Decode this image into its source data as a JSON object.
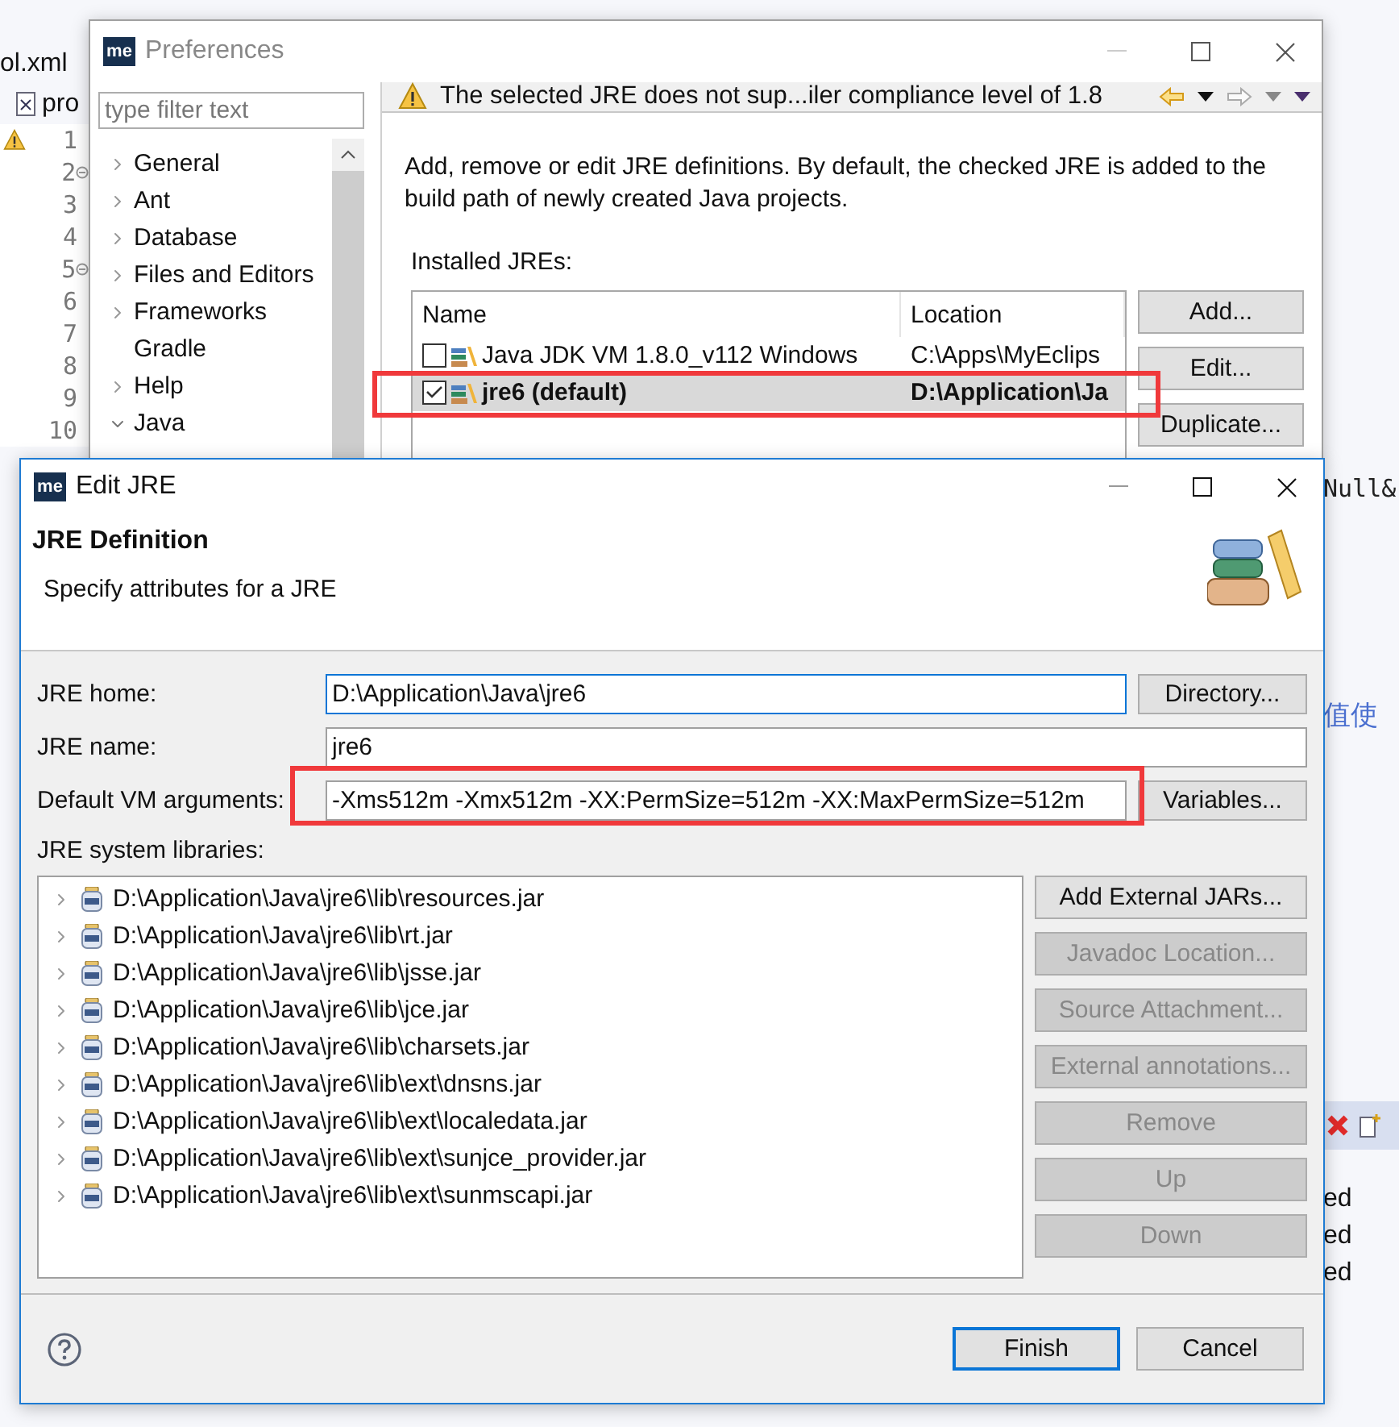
{
  "ide": {
    "editor_tabs": [
      {
        "label": "ol.xml",
        "kind": "plain"
      },
      {
        "label": "pro",
        "kind": "xml"
      }
    ],
    "line_numbers": [
      {
        "text": "1",
        "fold": false,
        "warning": true
      },
      {
        "text": "2",
        "fold": true,
        "warning": false
      },
      {
        "text": "3",
        "fold": false,
        "warning": false
      },
      {
        "text": "4",
        "fold": false,
        "warning": false
      },
      {
        "text": "5",
        "fold": true,
        "warning": false
      },
      {
        "text": "6",
        "fold": false,
        "warning": false
      },
      {
        "text": "7",
        "fold": false,
        "warning": false
      },
      {
        "text": "8",
        "fold": false,
        "warning": false
      },
      {
        "text": "9",
        "fold": false,
        "warning": false
      },
      {
        "text": "10",
        "fold": false,
        "warning": false
      }
    ],
    "code_fragment": "Null&",
    "comment_fragment": "值使",
    "console_lines": [
      "ed",
      "ed",
      "ed"
    ]
  },
  "preferences": {
    "logo": "me",
    "title": "Preferences",
    "filter": {
      "placeholder": "type filter text"
    },
    "tree": [
      {
        "label": "General",
        "expandable": true,
        "expanded": false
      },
      {
        "label": "Ant",
        "expandable": true,
        "expanded": false
      },
      {
        "label": "Database",
        "expandable": true,
        "expanded": false
      },
      {
        "label": "Files and Editors",
        "expandable": true,
        "expanded": false
      },
      {
        "label": "Frameworks",
        "expandable": true,
        "expanded": false
      },
      {
        "label": "Gradle",
        "expandable": false
      },
      {
        "label": "Help",
        "expandable": true,
        "expanded": false
      },
      {
        "label": "Java",
        "expandable": true,
        "expanded": true
      }
    ],
    "message": "The selected JRE does not sup...iler compliance level of 1.8",
    "description": "Add, remove or edit JRE definitions. By default, the checked JRE is added to the build path of newly created Java projects.",
    "installed_label": "Installed JREs:",
    "table": {
      "columns": [
        "Name",
        "Location"
      ],
      "rows": [
        {
          "name": "Java JDK VM 1.8.0_v112 Windows",
          "location": "C:\\Apps\\MyEclips",
          "checked": false,
          "selected": false
        },
        {
          "name": "jre6 (default)",
          "location": "D:\\Application\\Ja",
          "checked": true,
          "selected": true
        }
      ]
    },
    "buttons": [
      "Add...",
      "Edit...",
      "Duplicate..."
    ]
  },
  "edit_jre": {
    "logo": "me",
    "title": "Edit JRE",
    "heading": "JRE Definition",
    "subheading": "Specify attributes for a JRE",
    "fields": [
      {
        "label": "JRE home:",
        "value": "D:\\Application\\Java\\jre6",
        "focused": true,
        "button": {
          "label": "Directory..."
        }
      },
      {
        "label": "JRE name:",
        "value": "jre6",
        "focused": false
      },
      {
        "label": "Default VM arguments:",
        "value": "-Xms512m -Xmx512m -XX:PermSize=512m -XX:MaxPermSize=512m",
        "focused": false,
        "button": {
          "label": "Variables..."
        }
      }
    ],
    "libraries_label": "JRE system libraries:",
    "libraries": [
      "D:\\Application\\Java\\jre6\\lib\\resources.jar",
      "D:\\Application\\Java\\jre6\\lib\\rt.jar",
      "D:\\Application\\Java\\jre6\\lib\\jsse.jar",
      "D:\\Application\\Java\\jre6\\lib\\jce.jar",
      "D:\\Application\\Java\\jre6\\lib\\charsets.jar",
      "D:\\Application\\Java\\jre6\\lib\\ext\\dnsns.jar",
      "D:\\Application\\Java\\jre6\\lib\\ext\\localedata.jar",
      "D:\\Application\\Java\\jre6\\lib\\ext\\sunjce_provider.jar",
      "D:\\Application\\Java\\jre6\\lib\\ext\\sunmscapi.jar"
    ],
    "library_buttons": [
      {
        "label": "Add External JARs...",
        "disabled": false
      },
      {
        "label": "Javadoc Location...",
        "disabled": true
      },
      {
        "label": "Source Attachment...",
        "disabled": true
      },
      {
        "label": "External annotations...",
        "disabled": true
      },
      {
        "label": "Remove",
        "disabled": true
      },
      {
        "label": "Up",
        "disabled": true
      },
      {
        "label": "Down",
        "disabled": true
      }
    ],
    "footer_buttons": [
      {
        "label": "Finish",
        "default": true
      },
      {
        "label": "Cancel",
        "default": false
      }
    ]
  }
}
